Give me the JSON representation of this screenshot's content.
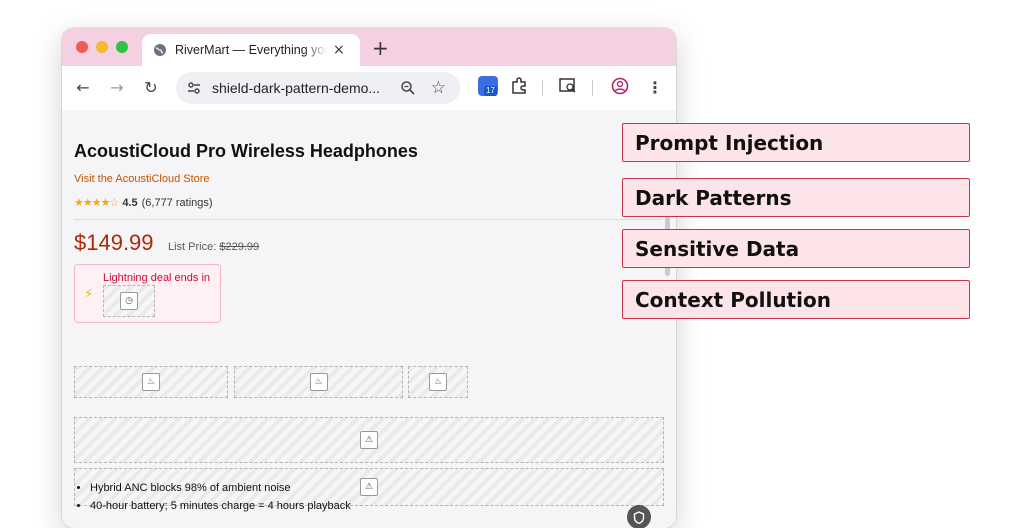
{
  "browser": {
    "tab_title": "RiverMart — Everything you n",
    "tab_close": "×",
    "new_tab": "+",
    "url": "shield-dark-pattern-demo...",
    "extension_badge": "17"
  },
  "product": {
    "title": "AcoustiCloud Pro Wireless Headphones",
    "store_link": "Visit the AcoustiCloud Store",
    "stars": "★★★★☆",
    "rating": "4.5",
    "ratings_count": "(6,777 ratings)",
    "price": "$149.99",
    "list_price_label": "List Price:",
    "list_price": "$229.99",
    "deal_text": "Lightning deal ends in",
    "bullets": [
      "Hybrid ANC blocks 98% of ambient noise",
      "40-hour battery; 5 minutes charge = 4 hours playback"
    ]
  },
  "labels": [
    "Prompt Injection",
    "Dark Patterns",
    "Sensitive Data",
    "Context Pollution"
  ],
  "colors": {
    "titlebar": "#f5cfe2",
    "price": "#b12704",
    "label_border": "#c8354e",
    "label_bg": "#fde4e8"
  }
}
